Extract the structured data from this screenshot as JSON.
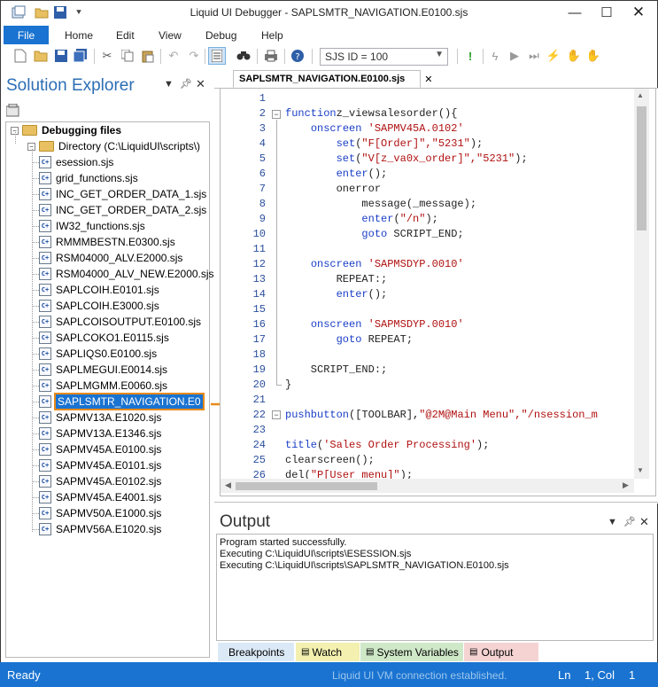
{
  "window": {
    "title": "Liquid UI Debugger - SAPLSMTR_NAVIGATION.E0100.sjs"
  },
  "menu": {
    "file": "File",
    "items": [
      "Home",
      "Edit",
      "View",
      "Debug",
      "Help"
    ]
  },
  "toolbar": {
    "sjs_id": "SJS ID = 100"
  },
  "solution_explorer": {
    "title": "Solution Explorer",
    "root": "Debugging files",
    "directory": "Directory (C:\\LiquidUI\\scripts\\)",
    "files": [
      "esession.sjs",
      "grid_functions.sjs",
      "INC_GET_ORDER_DATA_1.sjs",
      "INC_GET_ORDER_DATA_2.sjs",
      "IW32_functions.sjs",
      "RMMMBESTN.E0300.sjs",
      "RSM04000_ALV.E2000.sjs",
      "RSM04000_ALV_NEW.E2000.sjs",
      "SAPLCOIH.E0101.sjs",
      "SAPLCOIH.E3000.sjs",
      "SAPLCOISOUTPUT.E0100.sjs",
      "SAPLCOKO1.E0115.sjs",
      "SAPLIQS0.E0100.sjs",
      "SAPLMEGUI.E0014.sjs",
      "SAPLMGMM.E0060.sjs",
      "SAPLSMTR_NAVIGATION.E0",
      "SAPMV13A.E1020.sjs",
      "SAPMV13A.E1346.sjs",
      "SAPMV45A.E0100.sjs",
      "SAPMV45A.E0101.sjs",
      "SAPMV45A.E0102.sjs",
      "SAPMV45A.E4001.sjs",
      "SAPMV50A.E1000.sjs",
      "SAPMV56A.E1020.sjs"
    ],
    "selected_index": 15
  },
  "editor": {
    "tab": "SAPLSMTR_NAVIGATION.E0100.sjs",
    "lines": [
      {
        "n": "1",
        "t": []
      },
      {
        "n": "2",
        "t": [
          [
            "kw",
            "function"
          ],
          [
            "",
            "z_viewsalesorder(){"
          ]
        ]
      },
      {
        "n": "3",
        "t": [
          [
            "",
            "    "
          ],
          [
            "kw",
            "onscreen"
          ],
          [
            "str",
            " 'SAPMV45A.0102'"
          ]
        ]
      },
      {
        "n": "4",
        "t": [
          [
            "",
            "        "
          ],
          [
            "kw",
            "set"
          ],
          [
            "",
            "("
          ],
          [
            "str",
            "\"F[Order]\",\"5231\""
          ],
          [
            "",
            ");"
          ]
        ]
      },
      {
        "n": "5",
        "t": [
          [
            "",
            "        "
          ],
          [
            "kw",
            "set"
          ],
          [
            "",
            "("
          ],
          [
            "str",
            "\"V[z_va0x_order]\",\"5231\""
          ],
          [
            "",
            ");"
          ]
        ]
      },
      {
        "n": "6",
        "t": [
          [
            "",
            "        "
          ],
          [
            "kw",
            "enter"
          ],
          [
            "",
            "();"
          ]
        ]
      },
      {
        "n": "7",
        "t": [
          [
            "",
            "        onerror"
          ]
        ]
      },
      {
        "n": "8",
        "t": [
          [
            "",
            "            message(_message);"
          ]
        ]
      },
      {
        "n": "9",
        "t": [
          [
            "",
            "            "
          ],
          [
            "kw",
            "enter"
          ],
          [
            "",
            "("
          ],
          [
            "str",
            "\"/n\""
          ],
          [
            "",
            ");"
          ]
        ]
      },
      {
        "n": "10",
        "t": [
          [
            "",
            "            "
          ],
          [
            "kw",
            "goto"
          ],
          [
            "",
            " SCRIPT_END;"
          ]
        ]
      },
      {
        "n": "11",
        "t": []
      },
      {
        "n": "12",
        "t": [
          [
            "",
            "    "
          ],
          [
            "kw",
            "onscreen"
          ],
          [
            "str",
            " 'SAPMSDYP.0010'"
          ]
        ]
      },
      {
        "n": "13",
        "t": [
          [
            "",
            "        REPEAT:;"
          ]
        ]
      },
      {
        "n": "14",
        "t": [
          [
            "",
            "        "
          ],
          [
            "kw",
            "enter"
          ],
          [
            "",
            "();"
          ]
        ]
      },
      {
        "n": "15",
        "t": []
      },
      {
        "n": "16",
        "t": [
          [
            "",
            "    "
          ],
          [
            "kw",
            "onscreen"
          ],
          [
            "str",
            " 'SAPMSDYP.0010'"
          ]
        ]
      },
      {
        "n": "17",
        "t": [
          [
            "",
            "        "
          ],
          [
            "kw",
            "goto"
          ],
          [
            "",
            " REPEAT;"
          ]
        ]
      },
      {
        "n": "18",
        "t": []
      },
      {
        "n": "19",
        "t": [
          [
            "",
            "    SCRIPT_END:;"
          ]
        ]
      },
      {
        "n": "20",
        "t": [
          [
            "",
            "}"
          ]
        ]
      },
      {
        "n": "21",
        "t": []
      },
      {
        "n": "22",
        "t": [
          [
            "kw",
            "pushbutton"
          ],
          [
            "",
            "([TOOLBAR],"
          ],
          [
            "str",
            "\"@2M@Main Menu\",\"/nsession_m"
          ]
        ]
      },
      {
        "n": "23",
        "t": []
      },
      {
        "n": "24",
        "t": [
          [
            "kw",
            "title"
          ],
          [
            "",
            "("
          ],
          [
            "str",
            "'Sales Order Processing'"
          ],
          [
            "",
            ");"
          ]
        ]
      },
      {
        "n": "25",
        "t": [
          [
            "",
            "clearscreen();"
          ]
        ]
      },
      {
        "n": "26",
        "t": [
          [
            "",
            "del("
          ],
          [
            "str",
            "\"P[User menu]\""
          ],
          [
            "",
            ");"
          ]
        ]
      }
    ]
  },
  "output": {
    "title": "Output",
    "lines": [
      "Program started successfully.",
      "Executing C:\\LiquidUI\\scripts\\ESESSION.sjs",
      "Executing C:\\LiquidUI\\scripts\\SAPLSMTR_NAVIGATION.E0100.sjs"
    ],
    "tabs": [
      "Breakpoints",
      "Watch",
      "System Variables",
      "Output"
    ]
  },
  "status": {
    "ready": "Ready",
    "connection": "Liquid UI VM connection established.",
    "ln_label": "Ln",
    "ln_value": "1, Col",
    "col_value": "1"
  },
  "colors": {
    "accent": "#1a73d0",
    "selection_outline": "#e88a1a",
    "keyword": "#1a3ec7",
    "string": "#b01010"
  }
}
